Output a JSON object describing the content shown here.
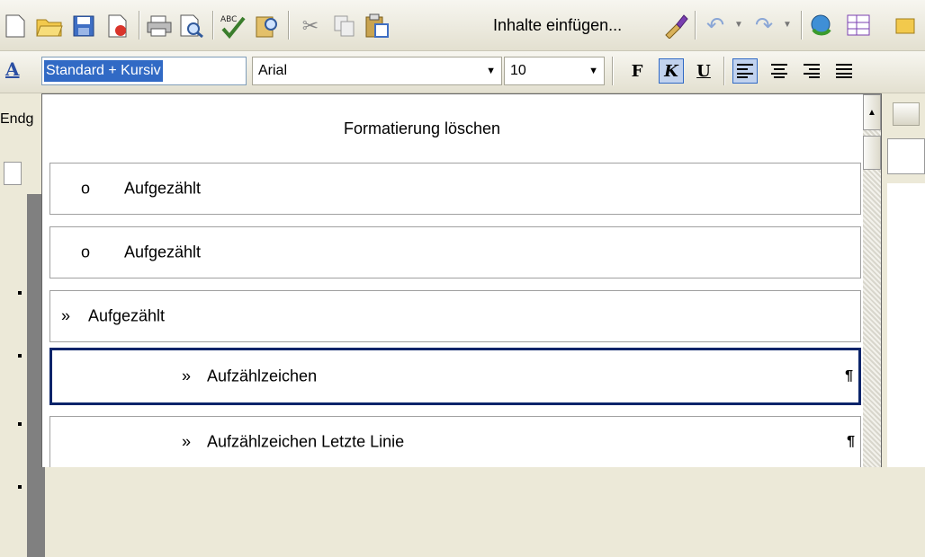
{
  "toolbar": {
    "icons": [
      "new-document-icon",
      "open-folder-icon",
      "save-icon",
      "permission-icon",
      "print-icon",
      "print-preview-icon",
      "spelling-icon",
      "research-icon",
      "cut-icon",
      "copy-icon",
      "paste-icon",
      "format-painter-icon",
      "undo-icon",
      "redo-icon",
      "hyperlink-icon",
      "tables-icon"
    ],
    "paste_label": "Inhalte einfügen..."
  },
  "formatting": {
    "style_value": "Standard + Kursiv",
    "font_value": "Arial",
    "size_value": "10",
    "bold_label": "F",
    "italic_label": "K",
    "underline_label": "U",
    "italic_active": true,
    "align_left_active": true
  },
  "background": {
    "left_text": "Endg"
  },
  "dropdown": {
    "clear_formatting": "Formatierung löschen",
    "items": [
      {
        "bullet": "o",
        "label": "Aufgezählt",
        "pilcrow": ""
      },
      {
        "bullet": "o",
        "label": "Aufgezählt",
        "pilcrow": ""
      },
      {
        "bullet": "»",
        "label": "Aufgezählt",
        "pilcrow": ""
      },
      {
        "bullet": "»",
        "label": "Aufzählzeichen",
        "pilcrow": "¶"
      },
      {
        "bullet": "»",
        "label": "Aufzählzeichen Letzte Linie",
        "pilcrow": "¶"
      }
    ],
    "selected_index": 3
  },
  "colors": {
    "selection_blue": "#316ac5",
    "selected_border": "#0a246a",
    "toolbar_bg": "#ece9d8"
  }
}
